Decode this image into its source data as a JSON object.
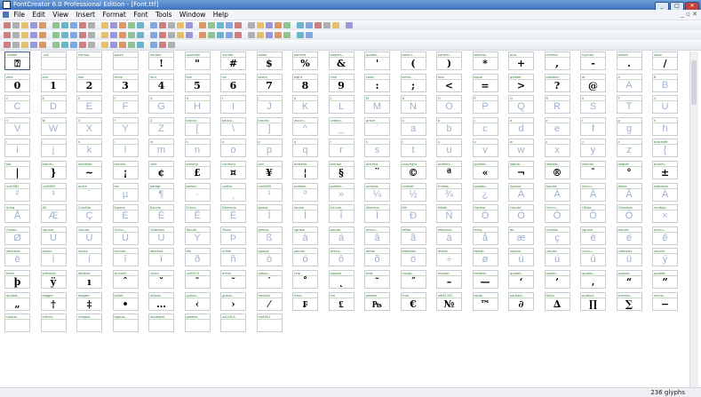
{
  "window": {
    "title": "FontCreator 6.0 Professional Edition - [Font.ttf]",
    "buttons": [
      "_",
      "□",
      "✕"
    ]
  },
  "menu": {
    "items": [
      "File",
      "Edit",
      "View",
      "Insert",
      "Format",
      "Font",
      "Tools",
      "Window",
      "Help"
    ],
    "mdi_controls": "_ ▫ ✕"
  },
  "status": {
    "glyph_count": "236 glyphs"
  },
  "glyphs": [
    {
      "n": ".notdef",
      "g": "⍰"
    },
    {
      "n": ".null",
      "g": ""
    },
    {
      "n": "nonma..",
      "g": ""
    },
    {
      "n": "space",
      "g": ""
    },
    {
      "n": "exclam",
      "g": "!"
    },
    {
      "n": "quotedbl",
      "g": "\""
    },
    {
      "n": "numbe..",
      "g": "#"
    },
    {
      "n": "dollar",
      "g": "$"
    },
    {
      "n": "percent",
      "g": "%"
    },
    {
      "n": "ampers..",
      "g": "&"
    },
    {
      "n": "quotes..",
      "g": "'"
    },
    {
      "n": "parenl..",
      "g": "("
    },
    {
      "n": "parenri..",
      "g": ")"
    },
    {
      "n": "asterisk",
      "g": "*"
    },
    {
      "n": "plus",
      "g": "+"
    },
    {
      "n": "comma",
      "g": ","
    },
    {
      "n": "hyphen",
      "g": "-"
    },
    {
      "n": "period",
      "g": "."
    },
    {
      "n": "slash",
      "g": "/"
    },
    {
      "n": "zero",
      "g": "0"
    },
    {
      "n": "one",
      "g": "1"
    },
    {
      "n": "two",
      "g": "2"
    },
    {
      "n": "three",
      "g": "3"
    },
    {
      "n": "four",
      "g": "4"
    },
    {
      "n": "five",
      "g": "5"
    },
    {
      "n": "six",
      "g": "6"
    },
    {
      "n": "seven",
      "g": "7"
    },
    {
      "n": "eight",
      "g": "8"
    },
    {
      "n": "nine",
      "g": "9"
    },
    {
      "n": "colon",
      "g": ":"
    },
    {
      "n": "semic..",
      "g": ";"
    },
    {
      "n": "less",
      "g": "<"
    },
    {
      "n": "equal",
      "g": "="
    },
    {
      "n": "greater",
      "g": ">"
    },
    {
      "n": "question",
      "g": "?"
    },
    {
      "n": "at",
      "g": "@"
    },
    {
      "n": "A",
      "g": "A"
    },
    {
      "n": "B",
      "g": "B"
    },
    {
      "n": "C",
      "g": "C"
    },
    {
      "n": "D",
      "g": "D"
    },
    {
      "n": "E",
      "g": "E"
    },
    {
      "n": "F",
      "g": "F"
    },
    {
      "n": "G",
      "g": "G"
    },
    {
      "n": "H",
      "g": "H"
    },
    {
      "n": "I",
      "g": "I"
    },
    {
      "n": "J",
      "g": "J"
    },
    {
      "n": "K",
      "g": "K"
    },
    {
      "n": "L",
      "g": "L"
    },
    {
      "n": "M",
      "g": "M"
    },
    {
      "n": "N",
      "g": "N"
    },
    {
      "n": "O",
      "g": "O"
    },
    {
      "n": "P",
      "g": "P"
    },
    {
      "n": "Q",
      "g": "Q"
    },
    {
      "n": "R",
      "g": "R"
    },
    {
      "n": "S",
      "g": "S"
    },
    {
      "n": "T",
      "g": "T"
    },
    {
      "n": "U",
      "g": "U"
    },
    {
      "n": "V",
      "g": "V"
    },
    {
      "n": "W",
      "g": "W"
    },
    {
      "n": "X",
      "g": "X"
    },
    {
      "n": "Y",
      "g": "Y"
    },
    {
      "n": "Z",
      "g": "Z"
    },
    {
      "n": "bracke..",
      "g": "["
    },
    {
      "n": "backsl..",
      "g": "\\"
    },
    {
      "n": "bracke..",
      "g": "]"
    },
    {
      "n": "asciici..",
      "g": "^"
    },
    {
      "n": "unders..",
      "g": "_"
    },
    {
      "n": "grave",
      "g": "`"
    },
    {
      "n": "a",
      "g": "a"
    },
    {
      "n": "b",
      "g": "b"
    },
    {
      "n": "c",
      "g": "c"
    },
    {
      "n": "d",
      "g": "d"
    },
    {
      "n": "e",
      "g": "e"
    },
    {
      "n": "f",
      "g": "f"
    },
    {
      "n": "g",
      "g": "g"
    },
    {
      "n": "h",
      "g": "h"
    },
    {
      "n": "i",
      "g": "i"
    },
    {
      "n": "j",
      "g": "j"
    },
    {
      "n": "k",
      "g": "k"
    },
    {
      "n": "l",
      "g": "l"
    },
    {
      "n": "m",
      "g": "m"
    },
    {
      "n": "n",
      "g": "n"
    },
    {
      "n": "o",
      "g": "o"
    },
    {
      "n": "p",
      "g": "p"
    },
    {
      "n": "q",
      "g": "q"
    },
    {
      "n": "r",
      "g": "r"
    },
    {
      "n": "s",
      "g": "s"
    },
    {
      "n": "t",
      "g": "t"
    },
    {
      "n": "u",
      "g": "u"
    },
    {
      "n": "v",
      "g": "v"
    },
    {
      "n": "w",
      "g": "w"
    },
    {
      "n": "x",
      "g": "x"
    },
    {
      "n": "y",
      "g": "y"
    },
    {
      "n": "z",
      "g": "z"
    },
    {
      "n": "braceleft",
      "g": "{"
    },
    {
      "n": "bar",
      "g": "|"
    },
    {
      "n": "braceri..",
      "g": "}"
    },
    {
      "n": "asciitilde",
      "g": "~"
    },
    {
      "n": "exclam..",
      "g": "¡"
    },
    {
      "n": "cent",
      "g": "¢"
    },
    {
      "n": "sterling",
      "g": "£"
    },
    {
      "n": "currency",
      "g": "¤"
    },
    {
      "n": "yen",
      "g": "¥"
    },
    {
      "n": "brokenb..",
      "g": "¦"
    },
    {
      "n": "section",
      "g": "§"
    },
    {
      "n": "dieresis",
      "g": "¨"
    },
    {
      "n": "copyright",
      "g": "©"
    },
    {
      "n": "ordfemi..",
      "g": "ª"
    },
    {
      "n": "guillem..",
      "g": "«"
    },
    {
      "n": "logical..",
      "g": "¬"
    },
    {
      "n": "register..",
      "g": "®"
    },
    {
      "n": "macron",
      "g": "¯"
    },
    {
      "n": "degree",
      "g": "°"
    },
    {
      "n": "plusmi..",
      "g": "±"
    },
    {
      "n": "uni00B2",
      "g": "²"
    },
    {
      "n": "uni00B3",
      "g": "³"
    },
    {
      "n": "acute",
      "g": "´"
    },
    {
      "n": "mu",
      "g": "µ"
    },
    {
      "n": "paragr..",
      "g": "¶"
    },
    {
      "n": "period..",
      "g": "·"
    },
    {
      "n": "cedilla",
      "g": "¸"
    },
    {
      "n": "uni00B9",
      "g": "¹"
    },
    {
      "n": "ordmas..",
      "g": "º"
    },
    {
      "n": "guillem..",
      "g": "»"
    },
    {
      "n": "onequa..",
      "g": "¼"
    },
    {
      "n": "onehalf",
      "g": "½"
    },
    {
      "n": "threeq..",
      "g": "¾"
    },
    {
      "n": "questio..",
      "g": "¿"
    },
    {
      "n": "Agrave",
      "g": "À"
    },
    {
      "n": "Aacute",
      "g": "Á"
    },
    {
      "n": "Acircu..",
      "g": "Â"
    },
    {
      "n": "Atilde",
      "g": "Ã"
    },
    {
      "n": "Adieresis",
      "g": "Ä"
    },
    {
      "n": "Aring",
      "g": "Å"
    },
    {
      "n": "AE",
      "g": "Æ"
    },
    {
      "n": "Ccedilla",
      "g": "Ç"
    },
    {
      "n": "Egrave",
      "g": "È"
    },
    {
      "n": "Eacute",
      "g": "É"
    },
    {
      "n": "Ecircu..",
      "g": "Ê"
    },
    {
      "n": "Edieresis",
      "g": "Ë"
    },
    {
      "n": "Igrave",
      "g": "Ì"
    },
    {
      "n": "Iacute",
      "g": "Í"
    },
    {
      "n": "Icircum..",
      "g": "Î"
    },
    {
      "n": "Idieresis",
      "g": "Ï"
    },
    {
      "n": "Eth",
      "g": "Ð"
    },
    {
      "n": "Ntilde",
      "g": "Ñ"
    },
    {
      "n": "Ograve",
      "g": "Ò"
    },
    {
      "n": "Oacute",
      "g": "Ó"
    },
    {
      "n": "Ocircu..",
      "g": "Ô"
    },
    {
      "n": "Otilde",
      "g": "Õ"
    },
    {
      "n": "Odieresis",
      "g": "Ö"
    },
    {
      "n": "multiply",
      "g": "×"
    },
    {
      "n": "Oslash",
      "g": "Ø"
    },
    {
      "n": "Ugrave",
      "g": "Ù"
    },
    {
      "n": "Uacute",
      "g": "Ú"
    },
    {
      "n": "Ucircu..",
      "g": "Û"
    },
    {
      "n": "Udieresis",
      "g": "Ü"
    },
    {
      "n": "Yacute",
      "g": "Ý"
    },
    {
      "n": "Thorn",
      "g": "Þ"
    },
    {
      "n": "germa..",
      "g": "ß"
    },
    {
      "n": "agrave",
      "g": "à"
    },
    {
      "n": "aacute",
      "g": "á"
    },
    {
      "n": "acircu..",
      "g": "â"
    },
    {
      "n": "atilde",
      "g": "ã"
    },
    {
      "n": "adieresis",
      "g": "ä"
    },
    {
      "n": "aring",
      "g": "å"
    },
    {
      "n": "ae",
      "g": "æ"
    },
    {
      "n": "ccedilla",
      "g": "ç"
    },
    {
      "n": "egrave",
      "g": "è"
    },
    {
      "n": "eacute",
      "g": "é"
    },
    {
      "n": "ecircu..",
      "g": "ê"
    },
    {
      "n": "edieresis",
      "g": "ë"
    },
    {
      "n": "igrave",
      "g": "ì"
    },
    {
      "n": "iacute",
      "g": "í"
    },
    {
      "n": "icircum..",
      "g": "î"
    },
    {
      "n": "idieresis",
      "g": "ï"
    },
    {
      "n": "eth",
      "g": "ð"
    },
    {
      "n": "ntilde",
      "g": "ñ"
    },
    {
      "n": "ograve",
      "g": "ò"
    },
    {
      "n": "oacute",
      "g": "ó"
    },
    {
      "n": "ocircu..",
      "g": "ô"
    },
    {
      "n": "otilde",
      "g": "õ"
    },
    {
      "n": "odieresis",
      "g": "ö"
    },
    {
      "n": "divide",
      "g": "÷"
    },
    {
      "n": "oslash",
      "g": "ø"
    },
    {
      "n": "ugrave",
      "g": "ù"
    },
    {
      "n": "uacute",
      "g": "ú"
    },
    {
      "n": "ucircu..",
      "g": "û"
    },
    {
      "n": "udieresis",
      "g": "ü"
    },
    {
      "n": "yacute",
      "g": "ý"
    },
    {
      "n": "thorn",
      "g": "þ"
    },
    {
      "n": "ydieresis",
      "g": "ÿ"
    },
    {
      "n": "dotlessi",
      "g": "ı"
    },
    {
      "n": "circumfl..",
      "g": "ˆ"
    },
    {
      "n": "caron",
      "g": "ˇ"
    },
    {
      "n": "uni02C9",
      "g": "ˉ"
    },
    {
      "n": "breve",
      "g": "˘"
    },
    {
      "n": "dotacc..",
      "g": "˙"
    },
    {
      "n": "ring",
      "g": "˚"
    },
    {
      "n": "ogonek",
      "g": "˛"
    },
    {
      "n": "tilde",
      "g": "˜"
    },
    {
      "n": "hunga..",
      "g": "˝"
    },
    {
      "n": "endash",
      "g": "–"
    },
    {
      "n": "emdash",
      "g": "—"
    },
    {
      "n": "quotell..",
      "g": "‘"
    },
    {
      "n": "quoter..",
      "g": "’"
    },
    {
      "n": "quotes..",
      "g": "‚"
    },
    {
      "n": "quoted..",
      "g": "“"
    },
    {
      "n": "quoted..",
      "g": "”"
    },
    {
      "n": "quoted..",
      "g": "„"
    },
    {
      "n": "dagger",
      "g": "†"
    },
    {
      "n": "dagger..",
      "g": "‡"
    },
    {
      "n": "bullet",
      "g": "•"
    },
    {
      "n": "ellipsis",
      "g": "…"
    },
    {
      "n": "guilsin..",
      "g": "‹"
    },
    {
      "n": "guilsin..",
      "g": "›"
    },
    {
      "n": "fraction",
      "g": "⁄"
    },
    {
      "n": "franc",
      "g": "₣"
    },
    {
      "n": "lira",
      "g": "₤"
    },
    {
      "n": "peseta",
      "g": "₧"
    },
    {
      "n": "Euro",
      "g": "€"
    },
    {
      "n": "afii61352",
      "g": "№"
    },
    {
      "n": "trade..",
      "g": "™"
    },
    {
      "n": "partiald..",
      "g": "∂"
    },
    {
      "n": "Delta",
      "g": "∆"
    },
    {
      "n": "product",
      "g": "∏"
    },
    {
      "n": "summa..",
      "g": "∑"
    },
    {
      "n": "minus",
      "g": "−"
    },
    {
      "n": "radical",
      "g": ""
    },
    {
      "n": "infinity",
      "g": ""
    },
    {
      "n": "integral",
      "g": ""
    },
    {
      "n": "approx..",
      "g": ""
    },
    {
      "n": "lessequal",
      "g": ""
    },
    {
      "n": "greater..",
      "g": ""
    },
    {
      "n": "uni25CA",
      "g": ""
    },
    {
      "n": "uniF001",
      "g": ""
    }
  ]
}
